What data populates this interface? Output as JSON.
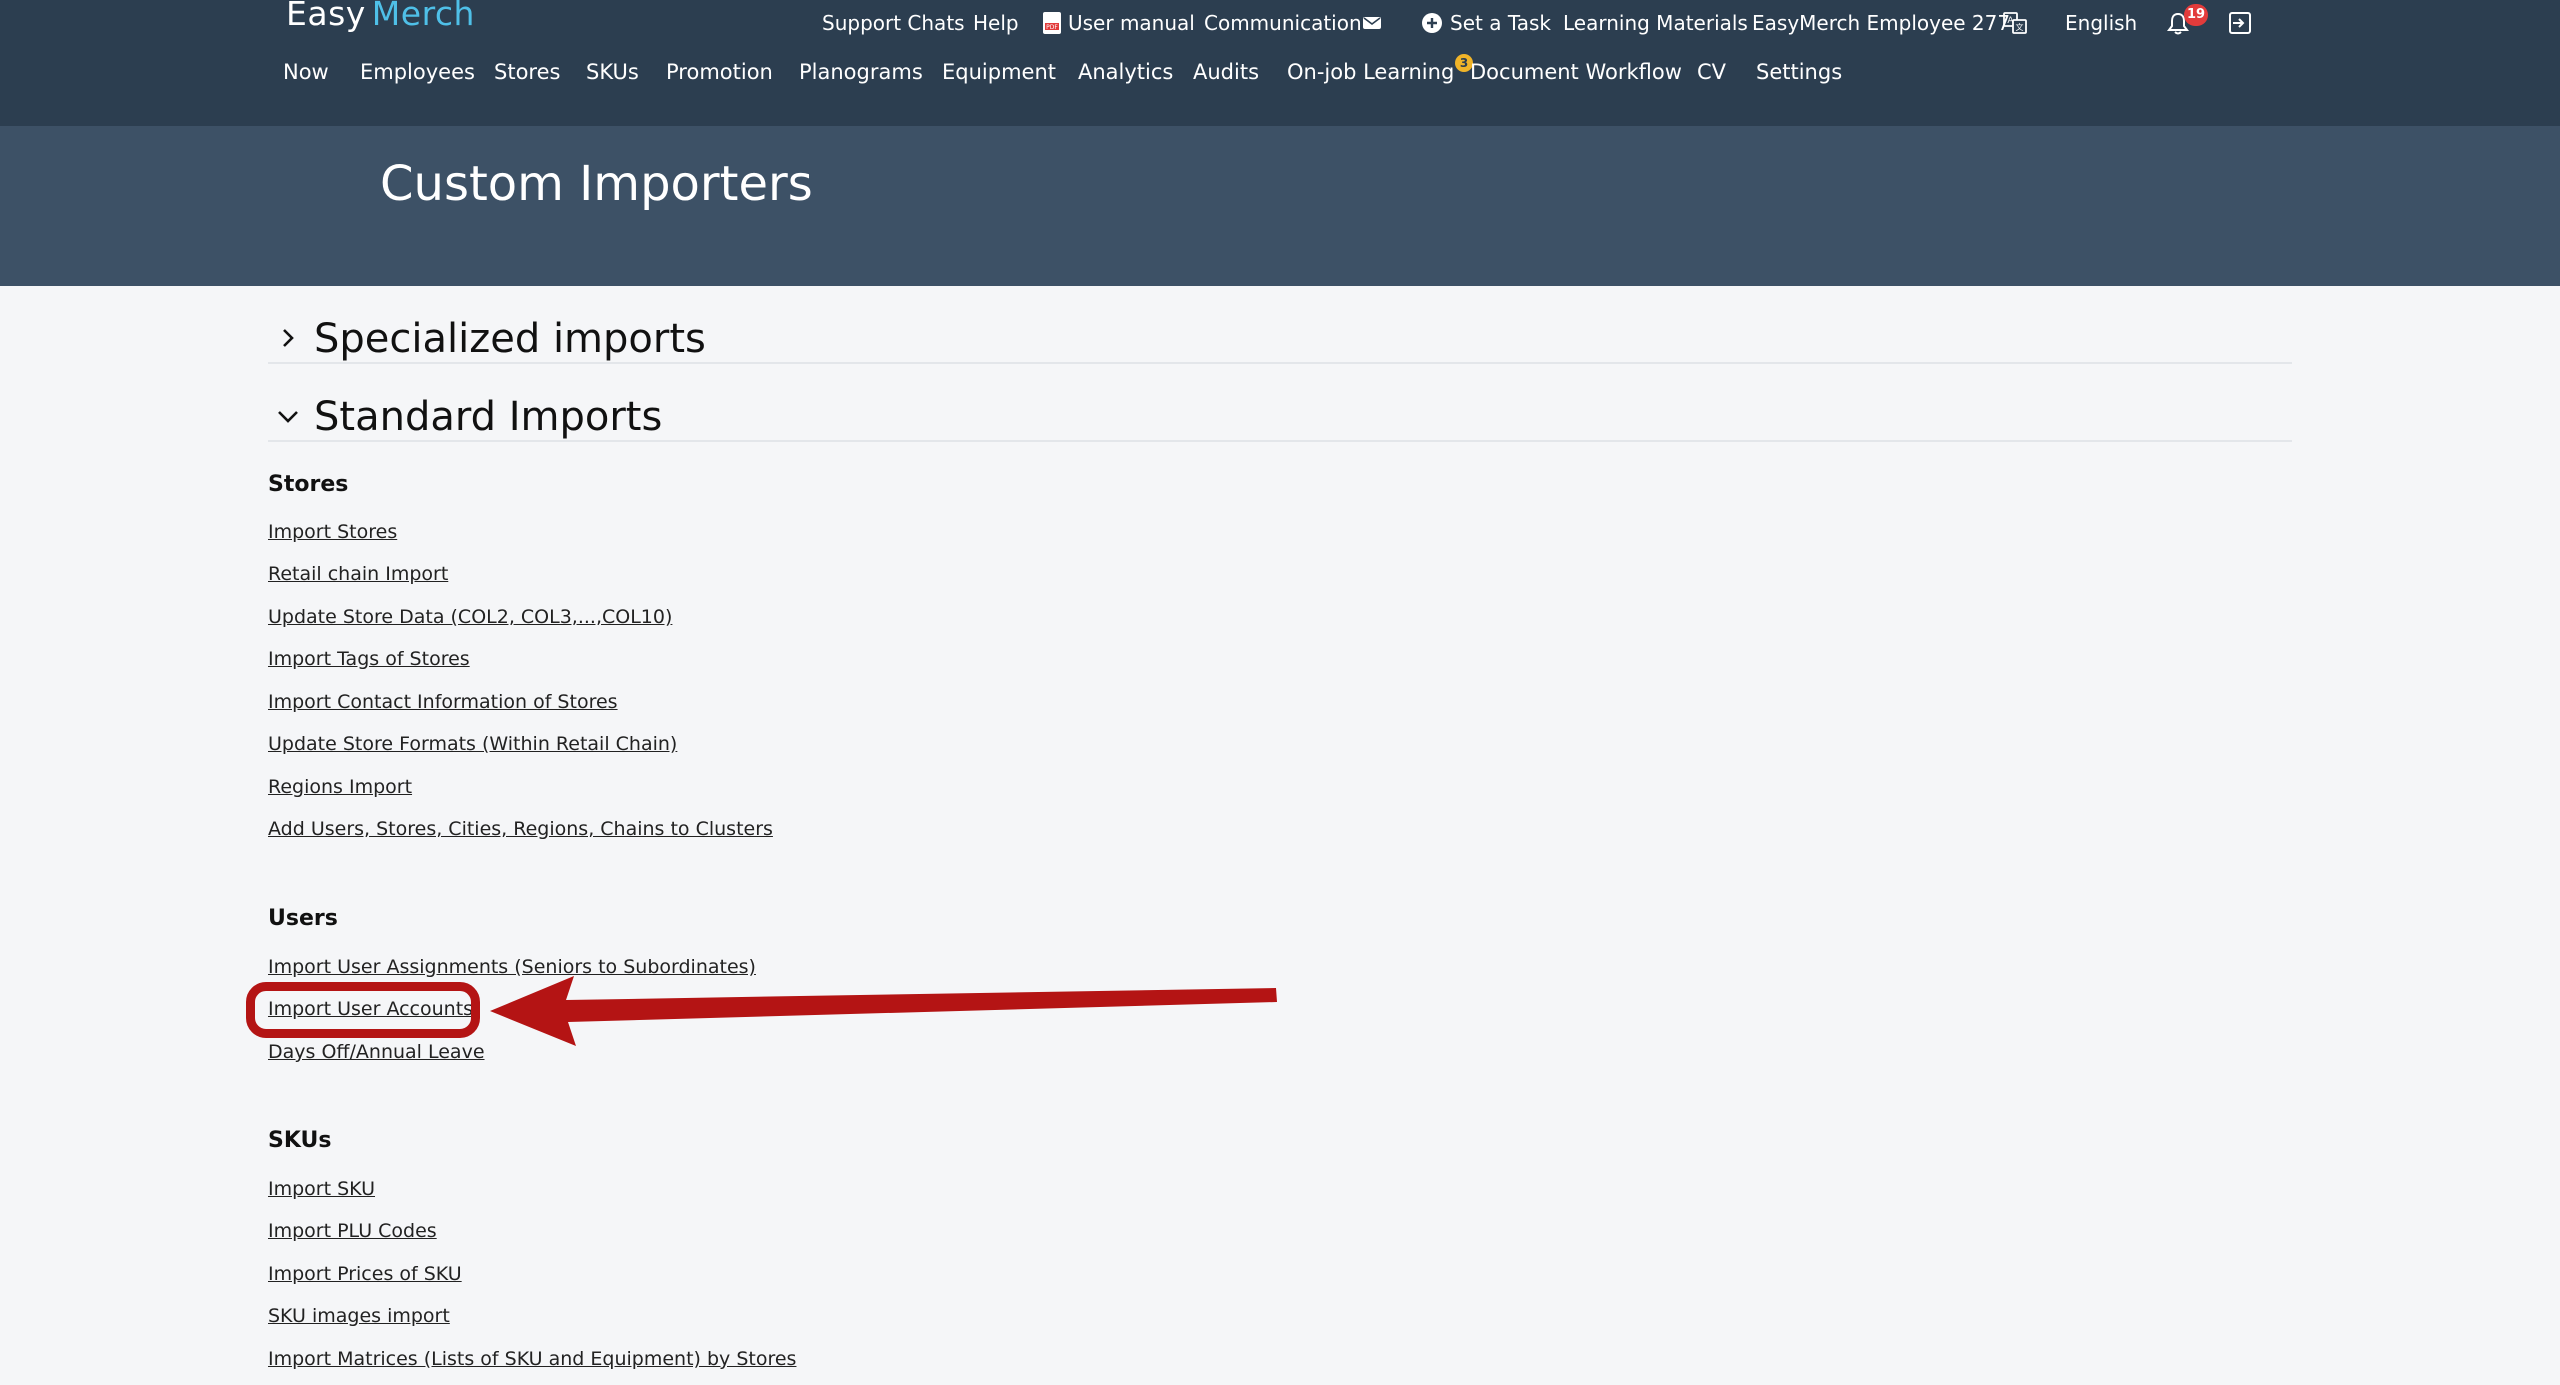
{
  "header": {
    "logo": {
      "part1": "Easy",
      "part2": "Merch"
    },
    "utility": {
      "support_chats": "Support Chats",
      "help": "Help",
      "user_manual": "User manual",
      "communication": "Communication",
      "set_task": "Set a Task",
      "learning_materials": "Learning Materials",
      "employee": "EasyMerch Employee 277",
      "language": "English",
      "notifications_count": "19"
    },
    "nav": {
      "now": "Now",
      "employees": "Employees",
      "stores": "Stores",
      "skus": "SKUs",
      "promotion": "Promotion",
      "planograms": "Planograms",
      "equipment": "Equipment",
      "analytics": "Analytics",
      "audits": "Audits",
      "onjob": "On-job Learning",
      "docflow": "Document Workflow",
      "docflow_badge": "3",
      "cv": "CV",
      "settings": "Settings"
    }
  },
  "page": {
    "title": "Custom Importers"
  },
  "sections": {
    "specialized": "Specialized imports",
    "standard": "Standard Imports"
  },
  "groups": {
    "stores": {
      "title": "Stores",
      "links": [
        "Import Stores",
        "Retail chain Import",
        "Update Store Data (COL2, COL3,...,COL10)",
        "Import Tags of Stores",
        "Import Contact Information of Stores",
        "Update Store Formats (Within Retail Chain)",
        "Regions Import",
        "Add Users, Stores, Cities, Regions, Chains to Clusters"
      ]
    },
    "users": {
      "title": "Users",
      "links": [
        "Import User Assignments (Seniors to Subordinates)",
        "Import User Accounts",
        "Days Off/Annual Leave"
      ]
    },
    "skus": {
      "title": "SKUs",
      "links": [
        "Import SKU",
        "Import PLU Codes",
        "Import Prices of SKU",
        "SKU images import",
        "Import Matrices (Lists of SKU and Equipment) by Stores"
      ]
    }
  },
  "colors": {
    "header_bg": "#2c3e50",
    "title_band_bg": "#3d5166",
    "logo_accent": "#4fc0e8",
    "annotation_red": "#b41414"
  }
}
